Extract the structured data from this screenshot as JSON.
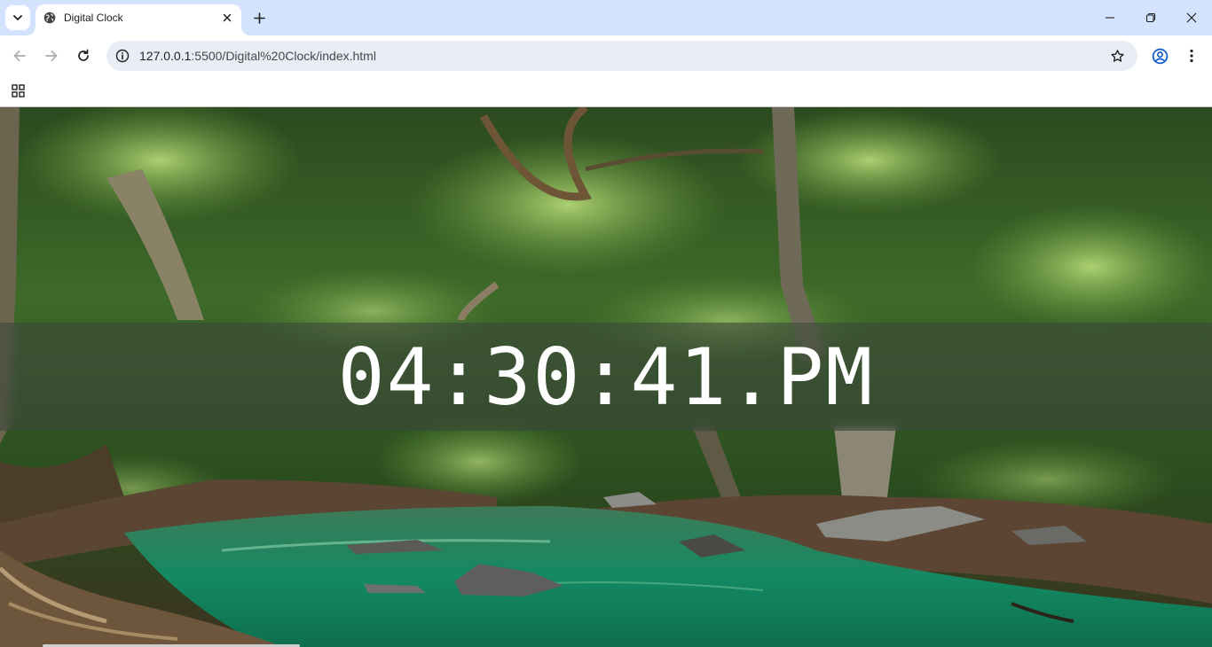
{
  "browser": {
    "tab": {
      "title": "Digital Clock",
      "favicon": "globe-icon"
    },
    "address_bar": {
      "url_host": "127.0.0.1",
      "url_rest": ":5500/Digital%20Clock/index.html"
    },
    "icons": {
      "tab_search": "chevron-down-icon",
      "close_tab": "close-icon",
      "new_tab": "plus-icon",
      "minimize": "minimize-icon",
      "restore": "restore-icon",
      "close_window": "close-icon",
      "back": "arrow-left-icon",
      "forward": "arrow-right-icon",
      "reload": "reload-icon",
      "site_info": "info-icon",
      "bookmark": "star-icon",
      "profile": "account-circle-icon",
      "menu": "kebab-menu-icon",
      "apps": "apps-grid-icon"
    },
    "colors": {
      "tabstrip": "#d3e3fd",
      "omnibox": "#e9eef6"
    }
  },
  "page": {
    "clock": {
      "time": "04:30:41.PM"
    },
    "background": "forest-river-photo",
    "colors": {
      "clock_text": "#ffffff",
      "band": "rgba(60,70,60,0.55)"
    }
  }
}
